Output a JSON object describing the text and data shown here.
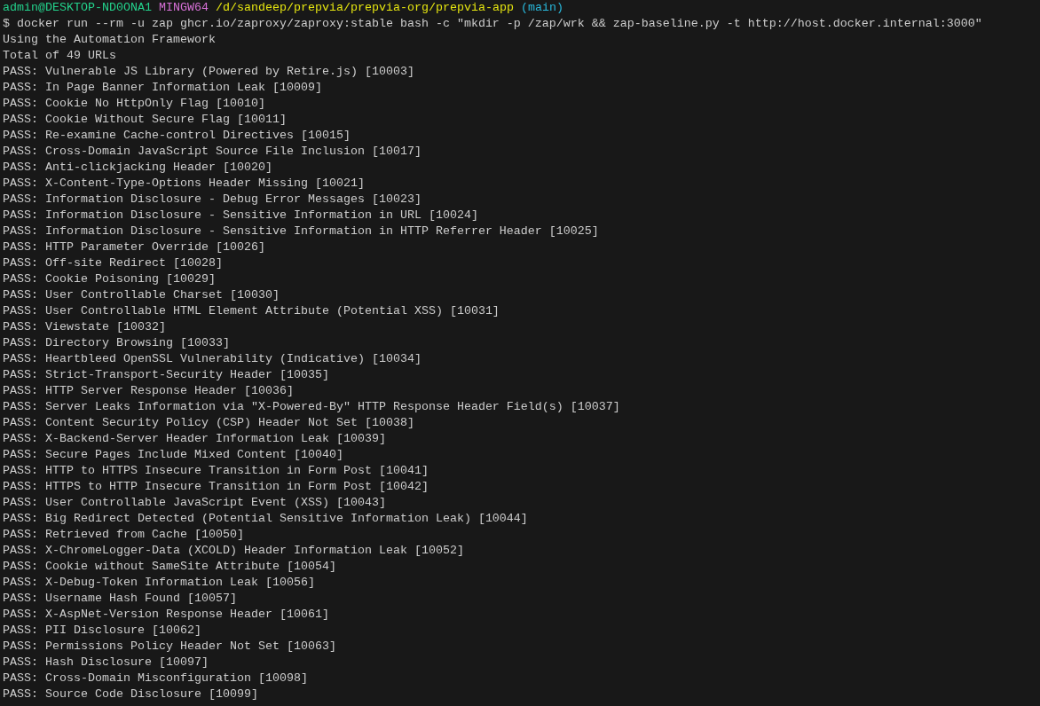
{
  "prompt": {
    "user_host": "admin@DESKTOP-ND0ONA1",
    "system": "MINGW64",
    "path": "/d/sandeep/prepvia/prepvia-org/prepvia-app",
    "branch": "(main)"
  },
  "command": "$ docker run --rm -u zap ghcr.io/zaproxy/zaproxy:stable bash -c \"mkdir -p /zap/wrk && zap-baseline.py -t http://host.docker.internal:3000\"",
  "output": [
    "Using the Automation Framework",
    "Total of 49 URLs",
    "PASS: Vulnerable JS Library (Powered by Retire.js) [10003]",
    "PASS: In Page Banner Information Leak [10009]",
    "PASS: Cookie No HttpOnly Flag [10010]",
    "PASS: Cookie Without Secure Flag [10011]",
    "PASS: Re-examine Cache-control Directives [10015]",
    "PASS: Cross-Domain JavaScript Source File Inclusion [10017]",
    "PASS: Anti-clickjacking Header [10020]",
    "PASS: X-Content-Type-Options Header Missing [10021]",
    "PASS: Information Disclosure - Debug Error Messages [10023]",
    "PASS: Information Disclosure - Sensitive Information in URL [10024]",
    "PASS: Information Disclosure - Sensitive Information in HTTP Referrer Header [10025]",
    "PASS: HTTP Parameter Override [10026]",
    "PASS: Off-site Redirect [10028]",
    "PASS: Cookie Poisoning [10029]",
    "PASS: User Controllable Charset [10030]",
    "PASS: User Controllable HTML Element Attribute (Potential XSS) [10031]",
    "PASS: Viewstate [10032]",
    "PASS: Directory Browsing [10033]",
    "PASS: Heartbleed OpenSSL Vulnerability (Indicative) [10034]",
    "PASS: Strict-Transport-Security Header [10035]",
    "PASS: HTTP Server Response Header [10036]",
    "PASS: Server Leaks Information via \"X-Powered-By\" HTTP Response Header Field(s) [10037]",
    "PASS: Content Security Policy (CSP) Header Not Set [10038]",
    "PASS: X-Backend-Server Header Information Leak [10039]",
    "PASS: Secure Pages Include Mixed Content [10040]",
    "PASS: HTTP to HTTPS Insecure Transition in Form Post [10041]",
    "PASS: HTTPS to HTTP Insecure Transition in Form Post [10042]",
    "PASS: User Controllable JavaScript Event (XSS) [10043]",
    "PASS: Big Redirect Detected (Potential Sensitive Information Leak) [10044]",
    "PASS: Retrieved from Cache [10050]",
    "PASS: X-ChromeLogger-Data (XCOLD) Header Information Leak [10052]",
    "PASS: Cookie without SameSite Attribute [10054]",
    "PASS: X-Debug-Token Information Leak [10056]",
    "PASS: Username Hash Found [10057]",
    "PASS: X-AspNet-Version Response Header [10061]",
    "PASS: PII Disclosure [10062]",
    "PASS: Permissions Policy Header Not Set [10063]",
    "PASS: Hash Disclosure [10097]",
    "PASS: Cross-Domain Misconfiguration [10098]",
    "PASS: Source Code Disclosure [10099]"
  ]
}
